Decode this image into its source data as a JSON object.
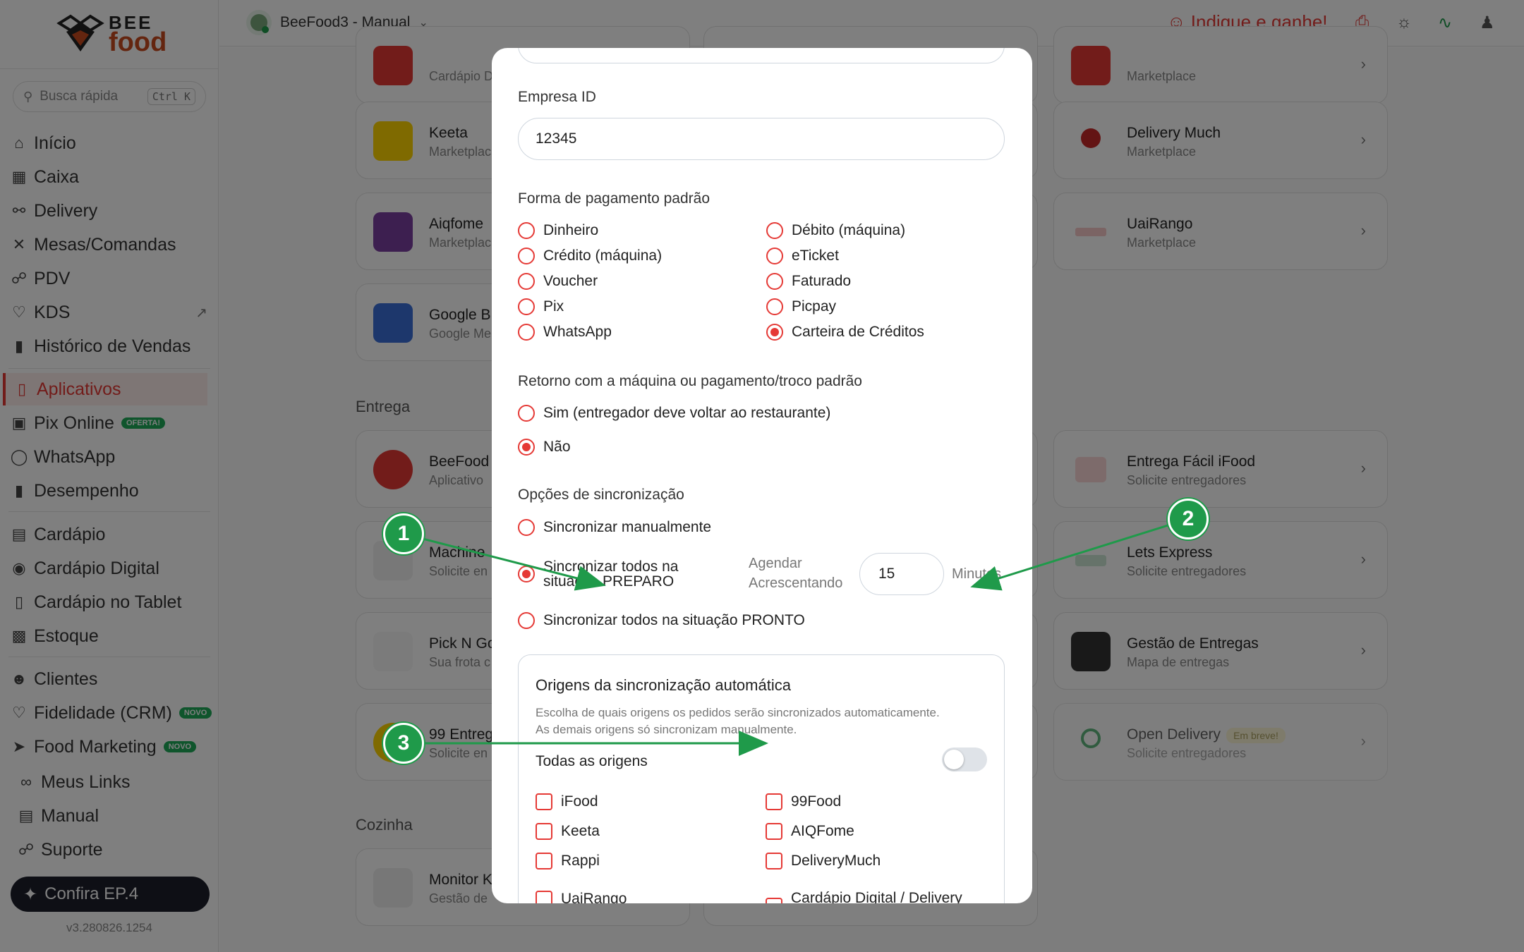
{
  "sidebar": {
    "logo": {
      "line1": "BEE",
      "line2": "food"
    },
    "search": {
      "placeholder": "Busca rápida",
      "shortcut": "Ctrl K"
    },
    "items": [
      {
        "label": "Início",
        "icon": "home-icon"
      },
      {
        "label": "Caixa",
        "icon": "cash-register-icon"
      },
      {
        "label": "Delivery",
        "icon": "bike-icon"
      },
      {
        "label": "Mesas/Comandas",
        "icon": "utensils-icon"
      },
      {
        "label": "PDV",
        "icon": "cart-icon"
      },
      {
        "label": "KDS",
        "icon": "chef-hat-icon"
      },
      {
        "label": "Histórico de Vendas",
        "icon": "bar-chart-icon"
      },
      {
        "label": "Aplicativos",
        "icon": "phone-icon"
      },
      {
        "label": "Pix Online",
        "icon": "card-icon",
        "badge": "OFERTA!"
      },
      {
        "label": "WhatsApp",
        "icon": "chat-icon"
      },
      {
        "label": "Desempenho",
        "icon": "bar-chart-icon"
      },
      {
        "label": "Cardápio",
        "icon": "book-icon"
      },
      {
        "label": "Cardápio Digital",
        "icon": "globe-icon"
      },
      {
        "label": "Cardápio no Tablet",
        "icon": "tablet-icon"
      },
      {
        "label": "Estoque",
        "icon": "boxes-icon"
      },
      {
        "label": "Clientes",
        "icon": "users-icon"
      },
      {
        "label": "Fidelidade (CRM)",
        "icon": "heart-icon",
        "badge": "NOVO"
      },
      {
        "label": "Food Marketing",
        "icon": "rocket-icon",
        "badge": "NOVO"
      },
      {
        "label": "Meus Links",
        "icon": "link-icon"
      },
      {
        "label": "Manual",
        "icon": "book-open-icon"
      },
      {
        "label": "Suporte",
        "icon": "headset-icon"
      }
    ],
    "cta": "Confira EP.4",
    "version": "v3.280826.1254"
  },
  "topbar": {
    "store_name": "BeeFood3 - Manual",
    "referral": "Indique e ganhe!"
  },
  "main": {
    "sections": {
      "entrega": "Entrega",
      "cozinha": "Cozinha"
    },
    "cards": [
      {
        "name": "",
        "sub": "Cardápio D",
        "color": "#e53935"
      },
      {
        "name": "Keeta",
        "sub": "Marketplac",
        "color": "#ffd400"
      },
      {
        "name": "Aiqfome",
        "sub": "Marketplac",
        "color": "#7b3fa0"
      },
      {
        "name": "Google B",
        "sub": "Google Me",
        "color": "#3b6fd8"
      },
      {
        "name": "BeeFood",
        "sub": "Aplicativo",
        "color": "#e53935"
      },
      {
        "name": "Machine",
        "sub": "Solicite en",
        "color": "#f0f0f0"
      },
      {
        "name": "Pick N Go",
        "sub": "Sua frota c",
        "color": "#f7f7f7"
      },
      {
        "name": "99 Entreg",
        "sub": "Solicite en",
        "color": "#ffd400"
      },
      {
        "name": "Monitor K",
        "sub": "Gestão de",
        "color": "#eeeeee"
      },
      {
        "name": "",
        "sub": "Marketplace",
        "color": "#e53935"
      },
      {
        "name": "Delivery Much",
        "sub": "Marketplace",
        "color": "#ffffff"
      },
      {
        "name": "UaiRango",
        "sub": "Marketplace",
        "color": "#ffffff"
      },
      {
        "name": "Entrega Fácil iFood",
        "sub": "Solicite entregadores",
        "color": "#ffffff"
      },
      {
        "name": "Lets Express",
        "sub": "Solicite entregadores",
        "color": "#ffffff"
      },
      {
        "name": "Gestão de Entregas",
        "sub": "Mapa de entregas",
        "color": "#333333"
      },
      {
        "name": "Open Delivery",
        "sub": "Solicite entregadores",
        "color": "#ffffff",
        "badge": "Em breve!"
      }
    ]
  },
  "modal": {
    "empresa_label": "Empresa ID",
    "empresa_value": "12345",
    "payment_label": "Forma de pagamento padrão",
    "payment_options": [
      {
        "label": "Dinheiro",
        "selected": false
      },
      {
        "label": "Débito (máquina)",
        "selected": false
      },
      {
        "label": "Crédito (máquina)",
        "selected": false
      },
      {
        "label": "eTicket",
        "selected": false
      },
      {
        "label": "Voucher",
        "selected": false
      },
      {
        "label": "Faturado",
        "selected": false
      },
      {
        "label": "Pix",
        "selected": false
      },
      {
        "label": "Picpay",
        "selected": false
      },
      {
        "label": "WhatsApp",
        "selected": false
      },
      {
        "label": "Carteira de Créditos",
        "selected": true
      }
    ],
    "return_label": "Retorno com a máquina ou pagamento/troco padrão",
    "return_options": [
      {
        "label": "Sim (entregador deve voltar ao restaurante)",
        "selected": false
      },
      {
        "label": "Não",
        "selected": true
      }
    ],
    "sync_label": "Opções de sincronização",
    "sync_manual": "Sincronizar manualmente",
    "sync_preparo_line1": "Sincronizar todos na",
    "sync_preparo_line2": "situação PREPARO",
    "sync_pronto": "Sincronizar todos na situação PRONTO",
    "agendar_line1": "Agendar",
    "agendar_line2": "Acrescentando",
    "minutes_value": "15",
    "minutes_unit": "Minutos",
    "origins_title": "Origens da sincronização automática",
    "origins_desc_line1": "Escolha de quais origens os pedidos serão sincronizados automaticamente.",
    "origins_desc_line2": "As demais origens só sincronizam manualmente.",
    "todas_label": "Todas as origens",
    "todas_enabled": false,
    "origins": [
      "iFood",
      "99Food",
      "Keeta",
      "AIQFome",
      "Rappi",
      "DeliveryMuch",
      "UaiRango",
      "Cardápio Digital / Delivery"
    ]
  },
  "annotations": [
    "1",
    "2",
    "3"
  ],
  "colors": {
    "accent": "#e53935",
    "annotation": "#1f9a4a"
  }
}
